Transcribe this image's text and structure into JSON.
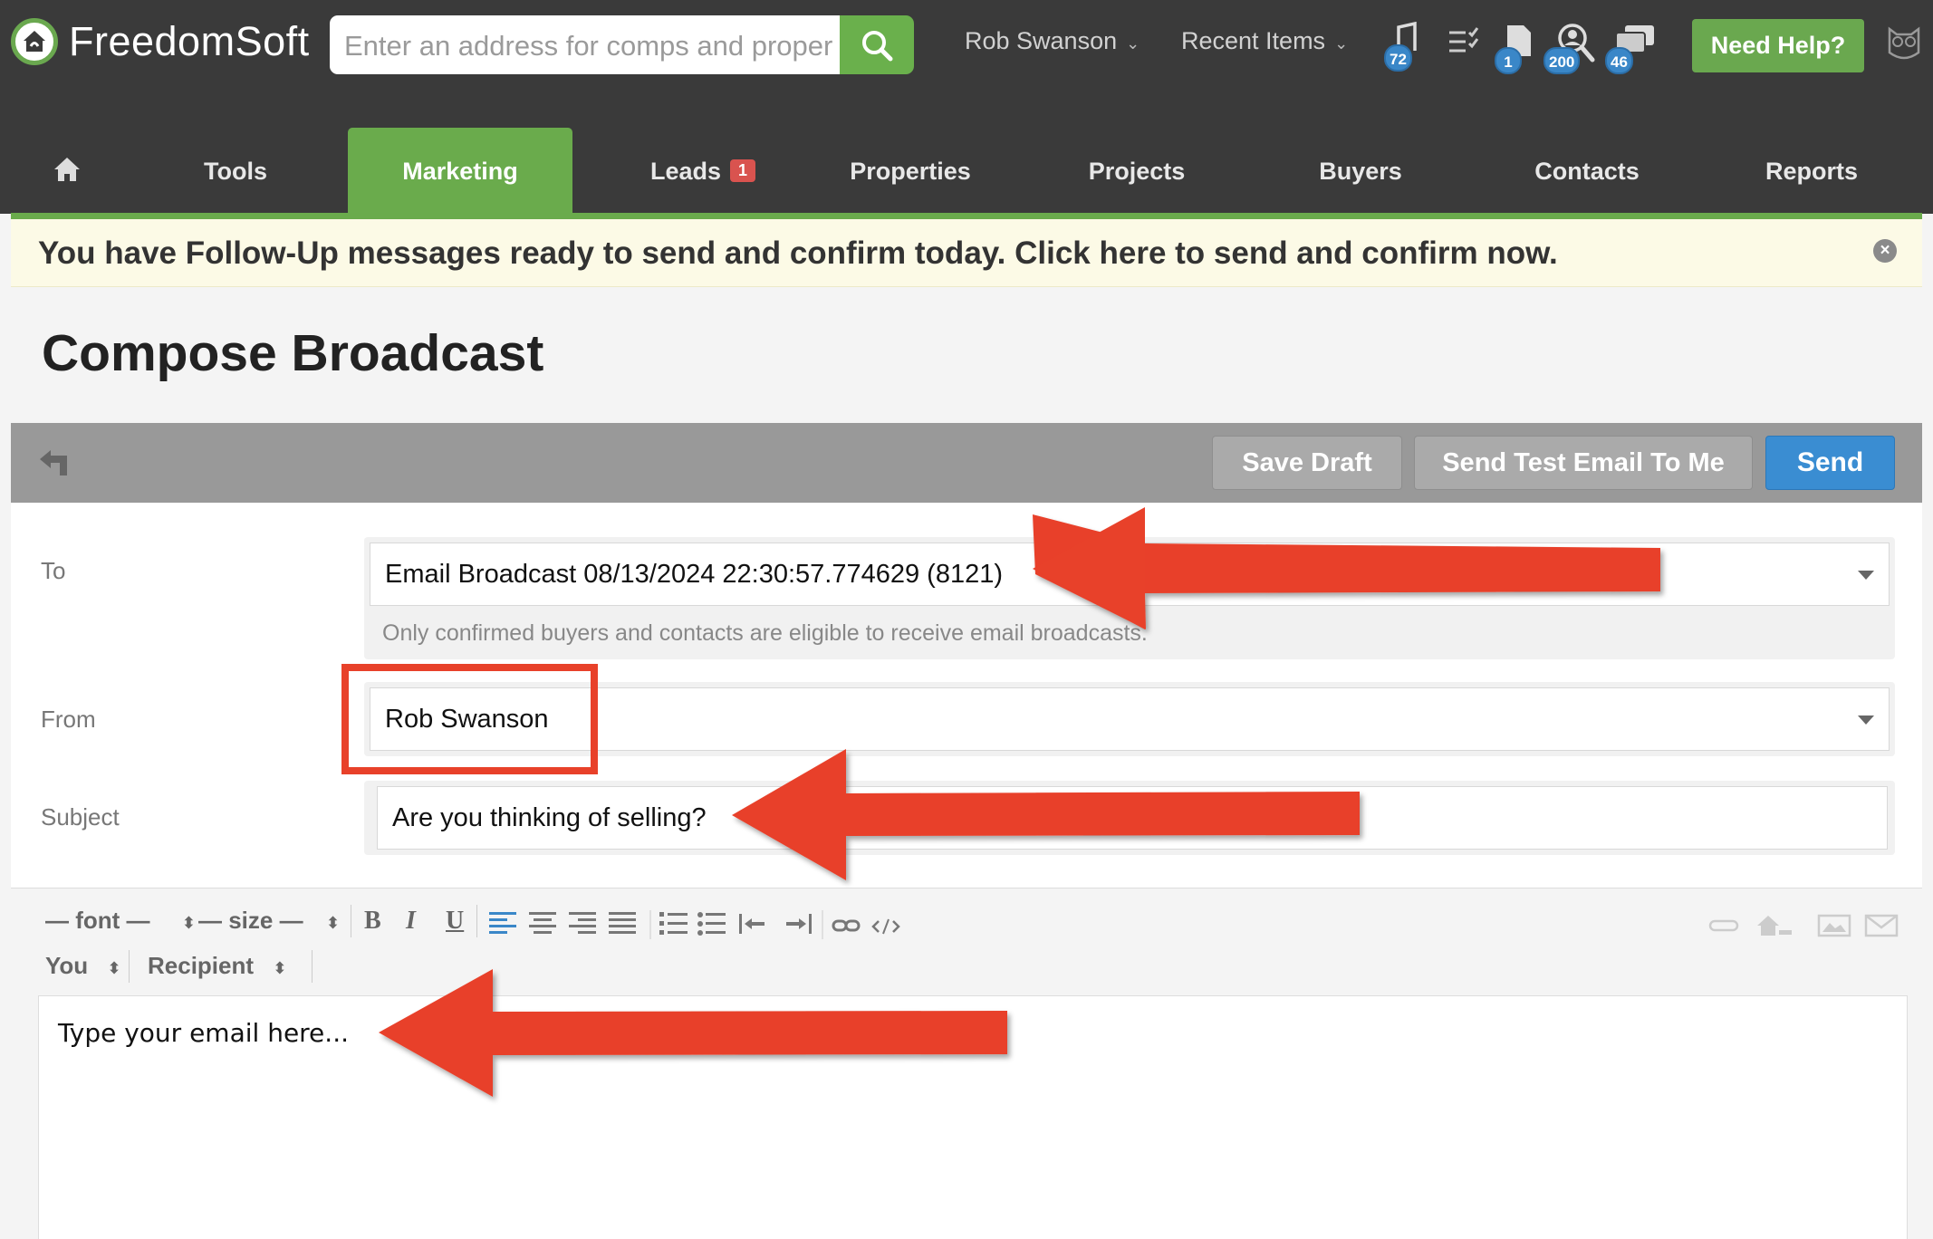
{
  "app": {
    "name": "FreedomSoft",
    "search_placeholder": "Enter an address for comps and proper",
    "user_menu": "Rob Swanson",
    "recent_items": "Recent Items",
    "help_button": "Need Help?",
    "badges": {
      "calls": "72",
      "files": "1",
      "leads": "200",
      "messages": "46"
    }
  },
  "nav": {
    "items": [
      "Tools",
      "Marketing",
      "Leads",
      "Properties",
      "Projects",
      "Buyers",
      "Contacts",
      "Reports"
    ],
    "leads_badge": "1",
    "active": "Marketing"
  },
  "alert": {
    "text": "You have Follow-Up messages ready to send and confirm today. Click here to send and confirm now."
  },
  "page": {
    "title": "Compose Broadcast"
  },
  "actions": {
    "save_draft": "Save Draft",
    "send_test": "Send Test Email To Me",
    "send": "Send"
  },
  "form": {
    "to_label": "To",
    "to_value": "Email Broadcast 08/13/2024 22:30:57.774629 (8121)",
    "to_help": "Only confirmed buyers and contacts are eligible to receive email broadcasts.",
    "from_label": "From",
    "from_value": "Rob Swanson",
    "subject_label": "Subject",
    "subject_value": "Are you thinking of selling?"
  },
  "editor": {
    "font_select": "— font —",
    "size_select": "— size —",
    "you_select": "You",
    "recipient_select": "Recipient",
    "bold": "B",
    "italic": "I",
    "underline": "U",
    "placeholder": "Type your email here..."
  },
  "colors": {
    "brand_green": "#6aab4c",
    "dark_bar": "#3a3a3a",
    "send_blue": "#3a8dd2",
    "annotation_red": "#e8412a"
  }
}
